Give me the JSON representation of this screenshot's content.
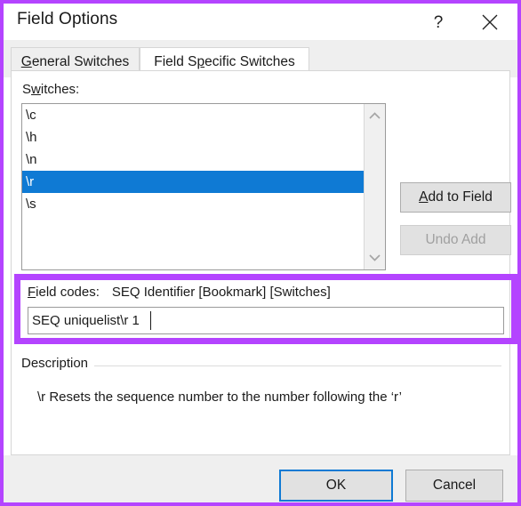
{
  "window": {
    "title": "Field Options",
    "help_icon": "question-mark-icon",
    "close_icon": "close-icon",
    "highlight_color": "#b444ff",
    "accent_color": "#0f7ad4"
  },
  "tabs": [
    {
      "label_before": "G",
      "label_underlined": "G",
      "label": "General Switches",
      "active": false
    },
    {
      "label": "Field Specific Switches",
      "active": true
    }
  ],
  "tab_labels": {
    "general_pre": "",
    "general_key": "G",
    "general_post": "eneral Switches",
    "specific_pre": "Field S",
    "specific_key": "p",
    "specific_post": "ecific Switches"
  },
  "switches": {
    "label_pre": "S",
    "label_key": "w",
    "label_post": "itches:",
    "items": [
      {
        "label": "\\c",
        "selected": false
      },
      {
        "label": "\\h",
        "selected": false
      },
      {
        "label": "\\n",
        "selected": false
      },
      {
        "label": "\\r",
        "selected": true
      },
      {
        "label": "\\s",
        "selected": false
      }
    ],
    "scroll_up_icon": "chevron-up-icon",
    "scroll_down_icon": "chevron-down-icon"
  },
  "side_buttons": {
    "add_pre": "",
    "add_key": "A",
    "add_post": "dd to Field",
    "add_label": "Add to Field",
    "undo_label": "Undo Add",
    "undo_disabled": true
  },
  "field_codes": {
    "label_key": "F",
    "label_post": "ield codes:",
    "pattern": "SEQ Identifier [Bookmark] [Switches]",
    "input_value": "SEQ uniquelist\\r 1",
    "input_placeholder": ""
  },
  "description": {
    "legend": "Description",
    "text": "\\r Resets the sequence number to the number following the ‘r’"
  },
  "footer": {
    "ok_label": "OK",
    "cancel_label": "Cancel"
  }
}
